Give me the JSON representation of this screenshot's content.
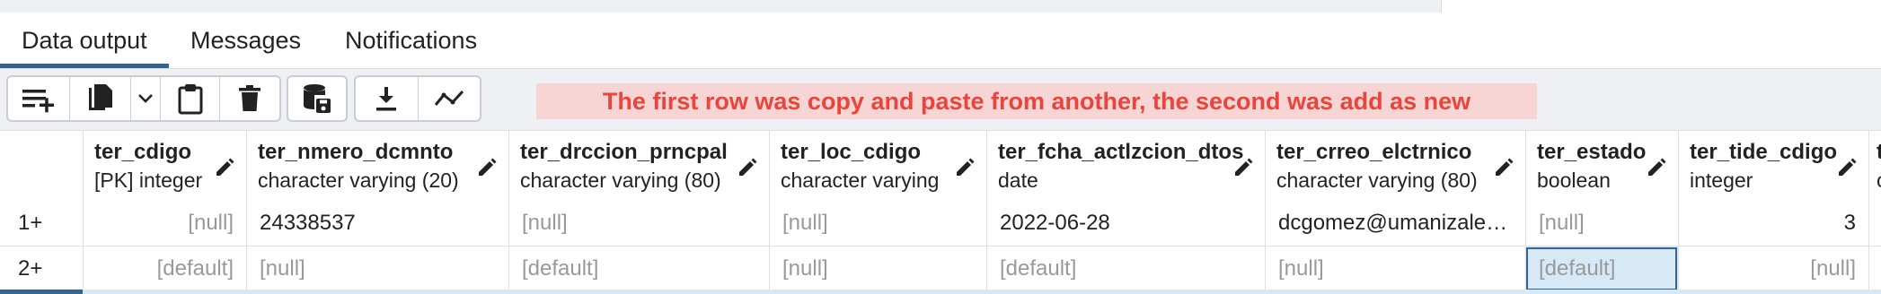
{
  "tabs": [
    {
      "label": "Data output",
      "active": true
    },
    {
      "label": "Messages",
      "active": false
    },
    {
      "label": "Notifications",
      "active": false
    }
  ],
  "toolbar": {
    "icons": [
      "add-row-icon",
      "copy-icon",
      "chevron-down-icon",
      "paste-icon",
      "delete-icon",
      "save-data-icon",
      "download-icon",
      "graph-icon"
    ]
  },
  "banner": "The first row was copy and paste from another, the second was add as new",
  "columns": [
    {
      "name": "ter_cdigo",
      "type": "[PK] integer"
    },
    {
      "name": "ter_nmero_dcmnto",
      "type": "character varying (20)"
    },
    {
      "name": "ter_drccion_prncpal",
      "type": "character varying (80)"
    },
    {
      "name": "ter_loc_cdigo",
      "type": "character varying"
    },
    {
      "name": "ter_fcha_actlzcion_dtos",
      "type": "date"
    },
    {
      "name": "ter_crreo_elctrnico",
      "type": "character varying (80)"
    },
    {
      "name": "ter_estado",
      "type": "boolean"
    },
    {
      "name": "ter_tide_cdigo",
      "type": "integer"
    },
    {
      "name": "t",
      "type": "c"
    }
  ],
  "rows": [
    {
      "num": "1+",
      "cells": [
        "[null]",
        "24338537",
        "[null]",
        "[null]",
        "2022-06-28",
        "dcgomez@umanizales...",
        "[null]",
        "3"
      ]
    },
    {
      "num": "2+",
      "cells": [
        "[default]",
        "[null]",
        "[default]",
        "[null]",
        "[default]",
        "[null]",
        "[default]",
        "[null]"
      ]
    }
  ],
  "colors": {
    "accent": "#326690",
    "banner_text": "#e8453c",
    "banner_bg": "#f7d5d5",
    "selected_bg": "#d7e8f7"
  }
}
